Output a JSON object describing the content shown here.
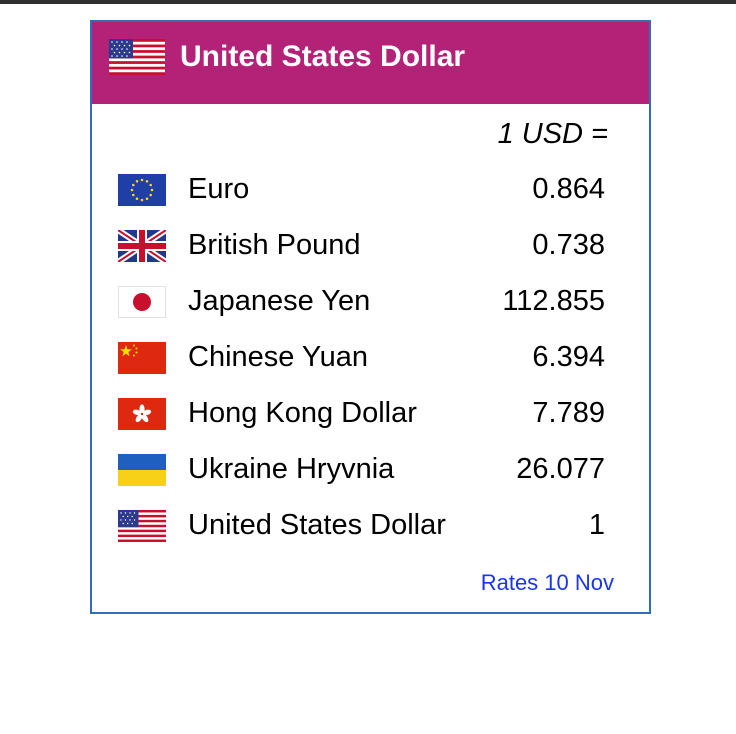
{
  "header": {
    "title": "United States Dollar",
    "flag_icon": "us-flag-icon",
    "background_color": "#b42278"
  },
  "unit_line": "1 USD =",
  "rows": [
    {
      "name": "Euro",
      "rate": "0.864",
      "flag_icon": "eu-flag-icon"
    },
    {
      "name": "British Pound",
      "rate": "0.738",
      "flag_icon": "uk-flag-icon"
    },
    {
      "name": "Japanese Yen",
      "rate": "112.855",
      "flag_icon": "japan-flag-icon"
    },
    {
      "name": "Chinese Yuan",
      "rate": "6.394",
      "flag_icon": "china-flag-icon"
    },
    {
      "name": "Hong Kong Dollar",
      "rate": "7.789",
      "flag_icon": "hong-kong-flag-icon"
    },
    {
      "name": "Ukraine Hryvnia",
      "rate": "26.077",
      "flag_icon": "ukraine-flag-icon"
    },
    {
      "name": "United States Dollar",
      "rate": "1",
      "flag_icon": "us-flag-icon"
    }
  ],
  "footer": {
    "link_text": "Rates 10 Nov",
    "link_color": "#1a36e8"
  },
  "colors": {
    "border": "#2f6dbd"
  }
}
